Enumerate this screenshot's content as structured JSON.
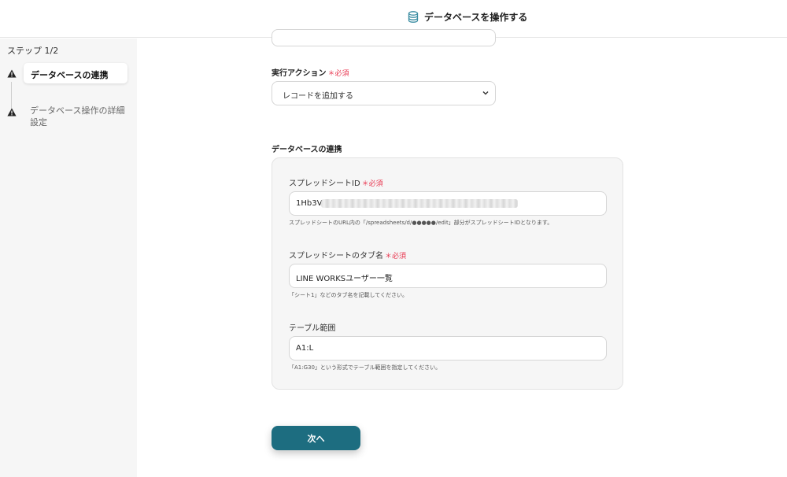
{
  "header": {
    "title": "データベースを操作する",
    "icon": "database-icon"
  },
  "sidebar": {
    "step_counter": "ステップ 1/2",
    "steps": [
      {
        "label": "データベースの連携",
        "icon": "warning-icon",
        "active": true
      },
      {
        "label": "データベース操作の詳細設定",
        "icon": "warning-icon",
        "active": false
      }
    ]
  },
  "form": {
    "action": {
      "label": "実行アクション",
      "required": "＊必須",
      "value": "レコードを追加する"
    },
    "section_title": "データベースの連携",
    "spreadsheet_id": {
      "label": "スプレッドシートID",
      "required": "＊必須",
      "value": "1Hb3V",
      "hint": "スプレッドシートのURL内の「/spreadsheets/d/●●●●●/edit」部分がスプレッドシートIDとなります。"
    },
    "tab_name": {
      "label": "スプレッドシートのタブ名",
      "required": "＊必須",
      "value": "LINE WORKSユーザー一覧",
      "hint": "「シート1」などのタブ名を記載してください。"
    },
    "table_range": {
      "label": "テーブル範囲",
      "value": "A1:L",
      "hint": "「A1:G30」という形式でテーブル範囲を指定してください。"
    },
    "next_label": "次へ"
  },
  "colors": {
    "primary": "#1d6d80",
    "required": "#e8364f",
    "sidebar_bg": "#f6f6f6",
    "card_bg": "#f6f6f6"
  }
}
